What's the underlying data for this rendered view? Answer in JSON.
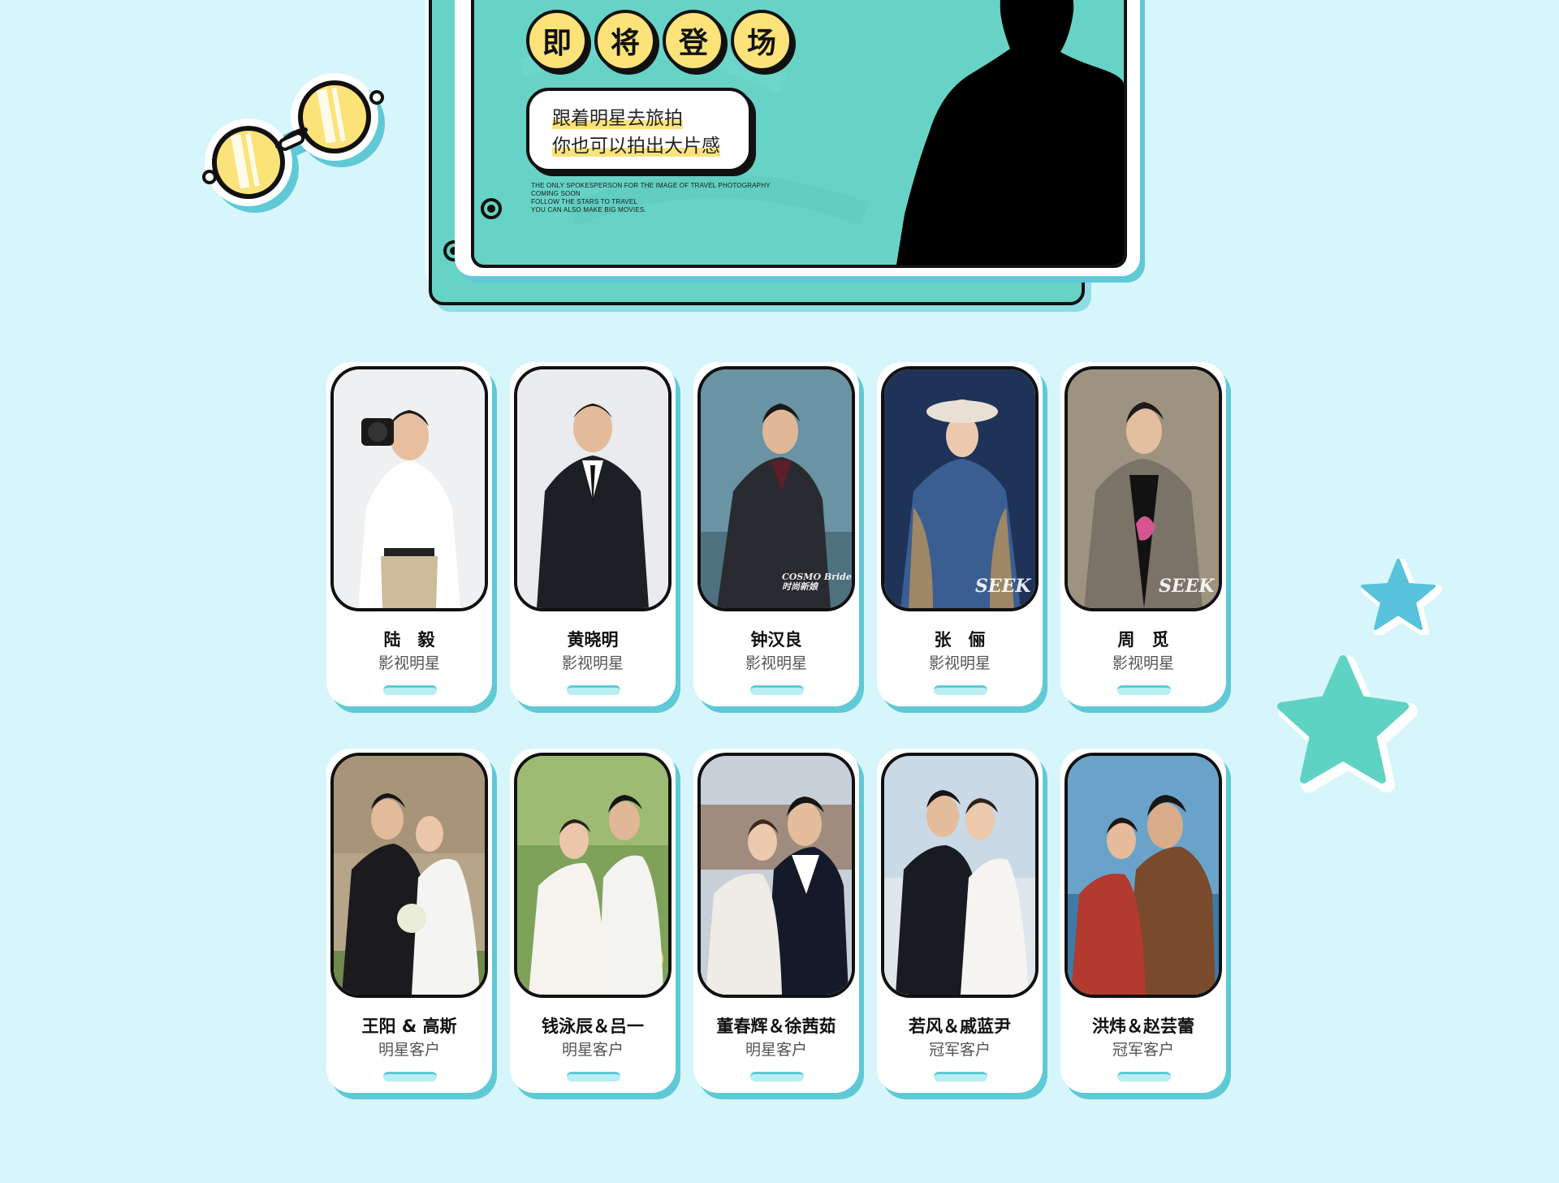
{
  "banner": {
    "title_chars": [
      "即",
      "将",
      "登",
      "场"
    ],
    "bubble_lines": [
      "跟着明星去旅拍",
      "你也可以拍出大片感"
    ],
    "english_lines": [
      "THE ONLY SPOKESPERSON FOR THE IMAGE OF TRAVEL PHOTOGRAPHY",
      "COMING SOON",
      "FOLLOW THE STARS TO TRAVEL",
      "YOU CAN ALSO MAKE BIG MOVIES."
    ]
  },
  "celebrities": [
    {
      "name": "陆　毅",
      "role": "影视明星"
    },
    {
      "name": "黄晓明",
      "role": "影视明星"
    },
    {
      "name": "钟汉良",
      "role": "影视明星",
      "watermark": "COSMO Bride 时尚新娘"
    },
    {
      "name": "张　俪",
      "role": "影视明星",
      "watermark": "SEEK"
    },
    {
      "name": "周　觅",
      "role": "影视明星",
      "watermark": "SEEK"
    }
  ],
  "clients": [
    {
      "name": "王阳 & 高斯",
      "role": "明星客户"
    },
    {
      "name": "钱泳辰＆吕一",
      "role": "明星客户"
    },
    {
      "name": "董春辉＆徐茜茹",
      "role": "明星客户"
    },
    {
      "name": "若风＆戚蓝尹",
      "role": "冠军客户"
    },
    {
      "name": "洪炜＆赵芸蕾",
      "role": "冠军客户"
    }
  ],
  "colors": {
    "background": "#d7f6fb",
    "board": "#67d3c6",
    "accent_yellow": "#fbe37a",
    "shadow_blue": "#5fc9d6",
    "star_blue": "#57c3dc",
    "star_teal": "#5fd3c3"
  },
  "icons": [
    "glasses-icon",
    "star-icon"
  ]
}
